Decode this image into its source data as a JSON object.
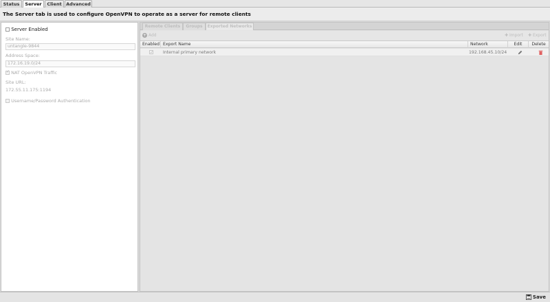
{
  "tabs": [
    {
      "label": "Status",
      "active": false
    },
    {
      "label": "Server",
      "active": true
    },
    {
      "label": "Client",
      "active": false
    },
    {
      "label": "Advanced",
      "active": false
    }
  ],
  "description": "The Server tab is used to configure OpenVPN to operate as a server for remote clients",
  "server_settings": {
    "server_enabled_label": "Server Enabled",
    "site_name_label": "Site Name:",
    "site_name_value": "untangle-9844",
    "address_space_label": "Address Space:",
    "address_space_value": "172.16.19.0/24",
    "nat_label": "NAT OpenVPN Traffic",
    "site_url_label": "Site URL:",
    "site_url_value": "172.55.11.175:1194",
    "auth_label": "Username/Password Authentication"
  },
  "subtabs": [
    {
      "label": "Remote Clients"
    },
    {
      "label": "Groups"
    },
    {
      "label": "Exported Networks"
    }
  ],
  "toolbar": {
    "add_label": "Add",
    "import_label": "Import",
    "export_label": "Export"
  },
  "grid": {
    "headers": {
      "enabled": "Enabled",
      "export_name": "Export Name",
      "network": "Network",
      "edit": "Edit",
      "delete": "Delete"
    },
    "rows": [
      {
        "enabled": true,
        "export_name": "Internal primary network",
        "network": "192.168.45.10/24"
      }
    ]
  },
  "footer": {
    "save_label": "Save"
  },
  "colors": {
    "delete_icon": "#e06060",
    "accent": "#333333"
  }
}
